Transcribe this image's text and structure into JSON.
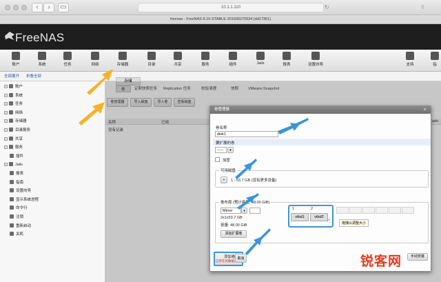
{
  "browser": {
    "url": "10.1.1.110",
    "tab_title": "freenas - FreeNAS-9.10-STABLE-201606270534 (dd17351)",
    "back_icon": "chevron-left-icon",
    "forward_icon": "chevron-right-icon",
    "sidebar_icon": "sidebar-icon",
    "reload_icon": "reload-icon"
  },
  "header": {
    "logo_text": "FreeNAS"
  },
  "toolbar": {
    "items": [
      {
        "label": "账户",
        "icon": "user-icon"
      },
      {
        "label": "系统",
        "icon": "monitor-icon"
      },
      {
        "label": "任务",
        "icon": "calendar-icon"
      },
      {
        "label": "网络",
        "icon": "network-icon"
      },
      {
        "label": "存储器",
        "icon": "folder-icon"
      },
      {
        "label": "目录",
        "icon": "directory-icon"
      },
      {
        "label": "共享",
        "icon": "share-icon"
      },
      {
        "label": "服务",
        "icon": "gear-icon"
      },
      {
        "label": "插件",
        "icon": "puzzle-icon"
      },
      {
        "label": "Jails",
        "icon": "jails-icon"
      },
      {
        "label": "报表",
        "icon": "chart-icon"
      },
      {
        "label": "设置向导",
        "icon": "wizard-icon"
      }
    ],
    "right_items": [
      {
        "label": "支持",
        "icon": "wrench-icon"
      },
      {
        "label": "指",
        "icon": "guide-icon"
      }
    ]
  },
  "strip": {
    "expand_all": "全部展开",
    "collapse_all": "折叠全部"
  },
  "sidebar": {
    "items": [
      {
        "label": "账户",
        "expandable": true
      },
      {
        "label": "系统",
        "expandable": true
      },
      {
        "label": "任务",
        "expandable": true
      },
      {
        "label": "网络",
        "expandable": true
      },
      {
        "label": "存储器",
        "expandable": true
      },
      {
        "label": "目录服务",
        "expandable": true
      },
      {
        "label": "共享",
        "expandable": true
      },
      {
        "label": "服务",
        "expandable": true
      },
      {
        "label": "插件",
        "expandable": false
      },
      {
        "label": "Jails",
        "expandable": true
      },
      {
        "label": "报表",
        "expandable": false
      },
      {
        "label": "指南",
        "expandable": false
      },
      {
        "label": "设置向导",
        "expandable": false
      },
      {
        "label": "显示系统进程",
        "expandable": false
      },
      {
        "label": "命令行",
        "expandable": false
      },
      {
        "label": "注销",
        "expandable": false
      },
      {
        "label": "重新启动",
        "expandable": false
      },
      {
        "label": "关机",
        "expandable": false
      }
    ]
  },
  "main": {
    "page_tab": "存储",
    "subtabs": [
      "卷",
      "定期快照任务",
      "Replication 任务",
      "校验清理",
      "快照",
      "VMware-Snapshot"
    ],
    "action_buttons": [
      "卷管理器",
      "导入磁盘",
      "导入卷",
      "查看磁盘"
    ],
    "table_headers": [
      "名称",
      "已用"
    ],
    "empty_text": "没有记录",
    "right_label": "ado"
  },
  "dialog": {
    "title": "卷管理器",
    "name_label": "卷名称",
    "name_value": "disk1",
    "extend_label": "要扩展的卷",
    "extend_value": "-----",
    "encrypt_label": "加密",
    "available_label": "可用磁盘",
    "available_disks": "1 - 53.7 GB (没有更多设备)",
    "layout_label": "卷布局 (预计容量: 48.00 GiB)",
    "layout_type": "Mirror",
    "layout_detail": "2x1x53.7 GB",
    "capacity": "容量: 48.00 GiB",
    "add_extra_button": "添加扩展卷",
    "grid_columns": [
      "1",
      "2"
    ],
    "grid_disks": [
      "vtbd1",
      "vtbd2"
    ],
    "drag_tooltip": "拖拽以调整大小",
    "add_volume_button": "添加卷",
    "add_volume_warning": "已存在的数据将被清空",
    "cancel_button": "取消",
    "manual_button": "手动安装"
  },
  "watermark": {
    "text": "锐客网",
    "small": "ruike"
  },
  "colors": {
    "accent_arrow": "#f4b429",
    "annotation_blue": "#3b95d8",
    "header_bg": "#1e1e1e"
  }
}
